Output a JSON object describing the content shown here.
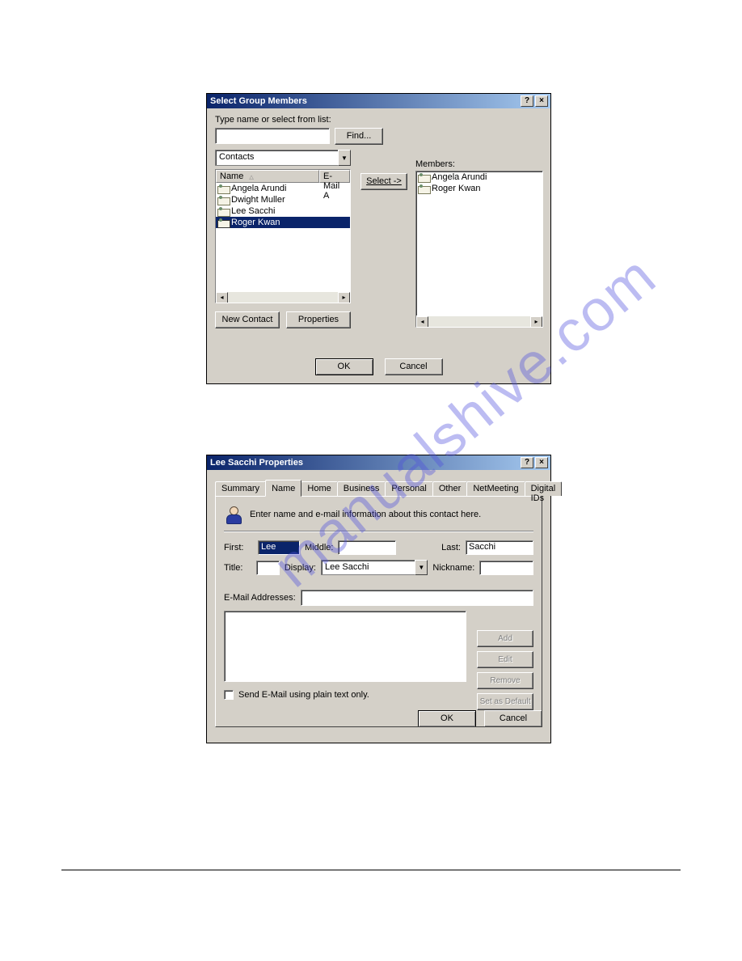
{
  "watermark": "manualshive.com",
  "dialog1": {
    "title": "Select Group Members",
    "help_icon": "?",
    "close_icon": "×",
    "type_label": "Type name or select from list:",
    "name_value": "",
    "find_label": "Find...",
    "source_combo": "Contacts",
    "columns": {
      "name": "Name",
      "email": "E-Mail A"
    },
    "contacts": [
      {
        "name": "Angela Arundi",
        "selected": false
      },
      {
        "name": "Dwight Muller",
        "selected": false
      },
      {
        "name": "Lee Sacchi",
        "selected": false
      },
      {
        "name": "Roger Kwan",
        "selected": true
      }
    ],
    "newcontact_label": "New Contact",
    "properties_label": "Properties",
    "select_label": "Select ->",
    "members_label": "Members:",
    "members": [
      {
        "name": "Angela Arundi"
      },
      {
        "name": "Roger Kwan"
      }
    ],
    "ok_label": "OK",
    "cancel_label": "Cancel"
  },
  "dialog2": {
    "title": "Lee Sacchi Properties",
    "help_icon": "?",
    "close_icon": "×",
    "tabs": [
      "Summary",
      "Name",
      "Home",
      "Business",
      "Personal",
      "Other",
      "NetMeeting",
      "Digital IDs"
    ],
    "active_tab": "Name",
    "intro_text": "Enter name and e-mail information about this contact here.",
    "labels": {
      "first": "First:",
      "middle": "Middle:",
      "last": "Last:",
      "title": "Title:",
      "display": "Display:",
      "nickname": "Nickname:",
      "email_addresses": "E-Mail Addresses:",
      "plaintext": "Send E-Mail using plain text only."
    },
    "values": {
      "first": "Lee",
      "middle": "",
      "last": "Sacchi",
      "title": "",
      "display": "Lee Sacchi",
      "nickname": "",
      "email": ""
    },
    "buttons": {
      "add": "Add",
      "edit": "Edit",
      "remove": "Remove",
      "set_default": "Set as Default",
      "ok": "OK",
      "cancel": "Cancel"
    }
  }
}
